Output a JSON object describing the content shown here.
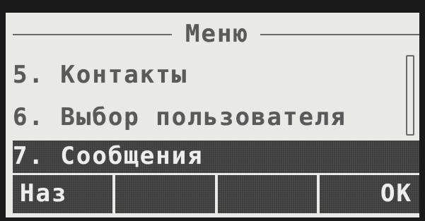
{
  "screen": {
    "title": "Меню",
    "items": [
      {
        "label": "5. Контакты"
      },
      {
        "label": "6. Выбор пользователя"
      }
    ],
    "selected_item": {
      "label": "7. Сообщения"
    }
  },
  "softkeys": [
    {
      "label": "Наз"
    },
    {
      "label": ""
    },
    {
      "label": ""
    },
    {
      "label": "ОК"
    }
  ],
  "colors": {
    "screen_bg": "#e9e9e6",
    "text": "#5a5a5a",
    "highlight_bg": "#3c3c3c",
    "highlight_text": "#ededed"
  }
}
